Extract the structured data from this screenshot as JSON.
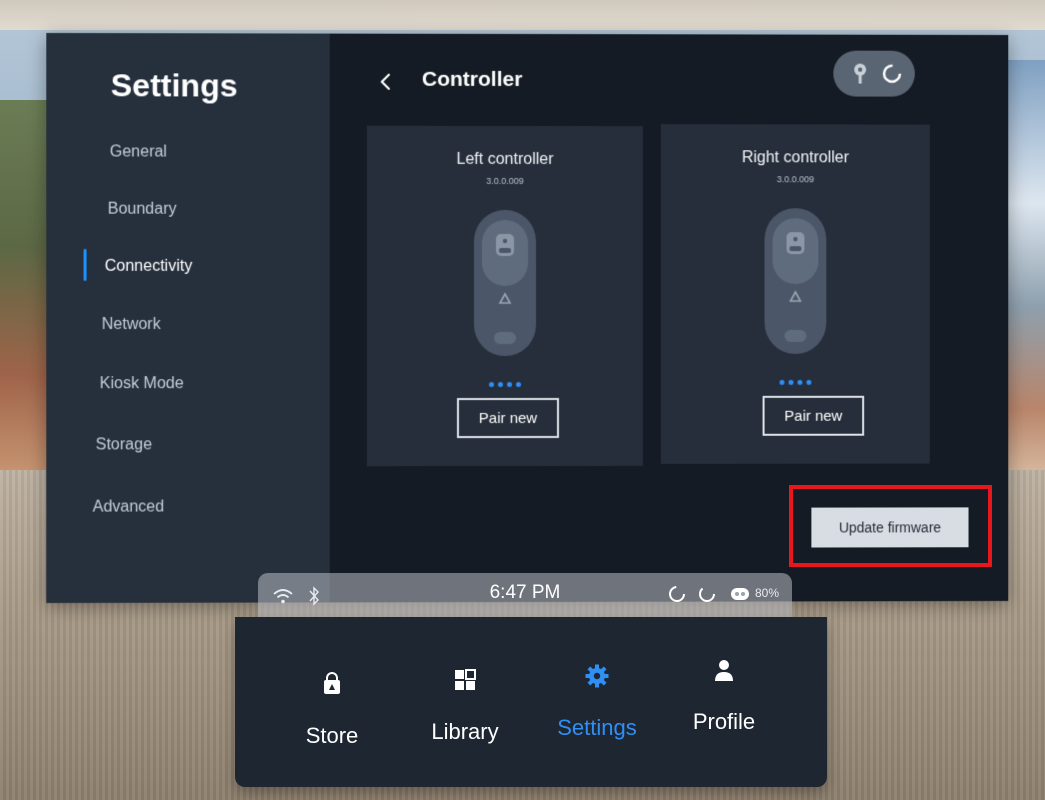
{
  "sidebar": {
    "title": "Settings",
    "items": [
      {
        "label": "General"
      },
      {
        "label": "Boundary"
      },
      {
        "label": "Connectivity",
        "active": true
      },
      {
        "label": "Network"
      },
      {
        "label": "Kiosk Mode"
      },
      {
        "label": "Storage"
      },
      {
        "label": "Advanced"
      }
    ]
  },
  "header": {
    "back_icon": "chevron-left-icon",
    "title": "Controller",
    "status_icons": [
      "controller-key-icon",
      "loading-ring-icon"
    ]
  },
  "controllers": {
    "left": {
      "title": "Left controller",
      "version": "3.0.0.009",
      "button": "Pair new"
    },
    "right": {
      "title": "Right controller",
      "version": "3.0.0.009",
      "button": "Pair new"
    }
  },
  "actions": {
    "update_firmware": "Update firmware"
  },
  "dock": {
    "status": {
      "time": "6:47 PM",
      "battery": "80%",
      "icons": [
        "wifi-icon",
        "bluetooth-icon",
        "loading-ring-icon",
        "loading-ring-icon",
        "headset-icon"
      ]
    },
    "items": [
      {
        "label": "Store",
        "icon": "shopping-bag-icon"
      },
      {
        "label": "Library",
        "icon": "grid-icon"
      },
      {
        "label": "Settings",
        "icon": "gear-icon",
        "active": true
      },
      {
        "label": "Profile",
        "icon": "person-icon"
      }
    ]
  },
  "colors": {
    "accent": "#2f8ff5",
    "highlight": "#e8161d",
    "panel": "#151b24",
    "sidebar": "#26303d"
  }
}
